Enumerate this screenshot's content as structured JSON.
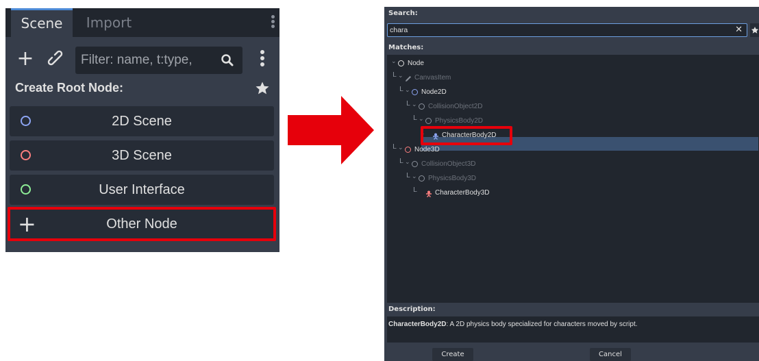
{
  "scene_dock": {
    "tabs": [
      {
        "label": "Scene"
      },
      {
        "label": "Import"
      }
    ],
    "filter": {
      "placeholder": "Filter: name, t:type,"
    },
    "create_root_label": "Create Root Node:",
    "root_buttons": [
      {
        "label": "2D Scene",
        "icon": "circle-icon",
        "color": "#8da5f3"
      },
      {
        "label": "3D Scene",
        "icon": "circle-icon",
        "color": "#fc7f7f"
      },
      {
        "label": "User Interface",
        "icon": "circle-icon",
        "color": "#8eef97"
      },
      {
        "label": "Other Node",
        "icon": "plus-icon"
      }
    ]
  },
  "dialog": {
    "search_label": "Search:",
    "search_value": "chara",
    "matches_label": "Matches:",
    "tree": [
      {
        "label": "Node",
        "depth": 0,
        "color": "#e0e0e0",
        "icon_color": "#e0e0e0",
        "dim": false
      },
      {
        "label": "CanvasItem",
        "depth": 1,
        "color": "#6c717a",
        "icon_color": "#8a909a",
        "dim": true
      },
      {
        "label": "Node2D",
        "depth": 2,
        "color": "#e0e0e0",
        "icon_color": "#8da5f3",
        "dim": false
      },
      {
        "label": "CollisionObject2D",
        "depth": 3,
        "color": "#6c717a",
        "icon_color": "#8a909a",
        "dim": true
      },
      {
        "label": "PhysicsBody2D",
        "depth": 4,
        "color": "#6c717a",
        "icon_color": "#8a909a",
        "dim": true
      },
      {
        "label": "CharacterBody2D",
        "depth": 5,
        "color": "#e0e0e0",
        "icon_color": "#8da5f3",
        "dim": false,
        "selected": true
      },
      {
        "label": "Node3D",
        "depth": 1,
        "color": "#e0e0e0",
        "icon_color": "#fc7f7f",
        "dim": false
      },
      {
        "label": "CollisionObject3D",
        "depth": 2,
        "color": "#6c717a",
        "icon_color": "#8a909a",
        "dim": true
      },
      {
        "label": "PhysicsBody3D",
        "depth": 3,
        "color": "#6c717a",
        "icon_color": "#8a909a",
        "dim": true
      },
      {
        "label": "CharacterBody3D",
        "depth": 4,
        "color": "#e0e0e0",
        "icon_color": "#fc7f7f",
        "dim": false
      }
    ],
    "description_label": "Description:",
    "description_name": "CharacterBody2D",
    "description_text": ": A 2D physics body specialized for characters moved by script.",
    "create_label": "Create",
    "cancel_label": "Cancel"
  },
  "colors": {
    "highlight": "#e6000b",
    "arrow": "#e6000b",
    "panel": "#363d4a",
    "field": "#21262e"
  }
}
